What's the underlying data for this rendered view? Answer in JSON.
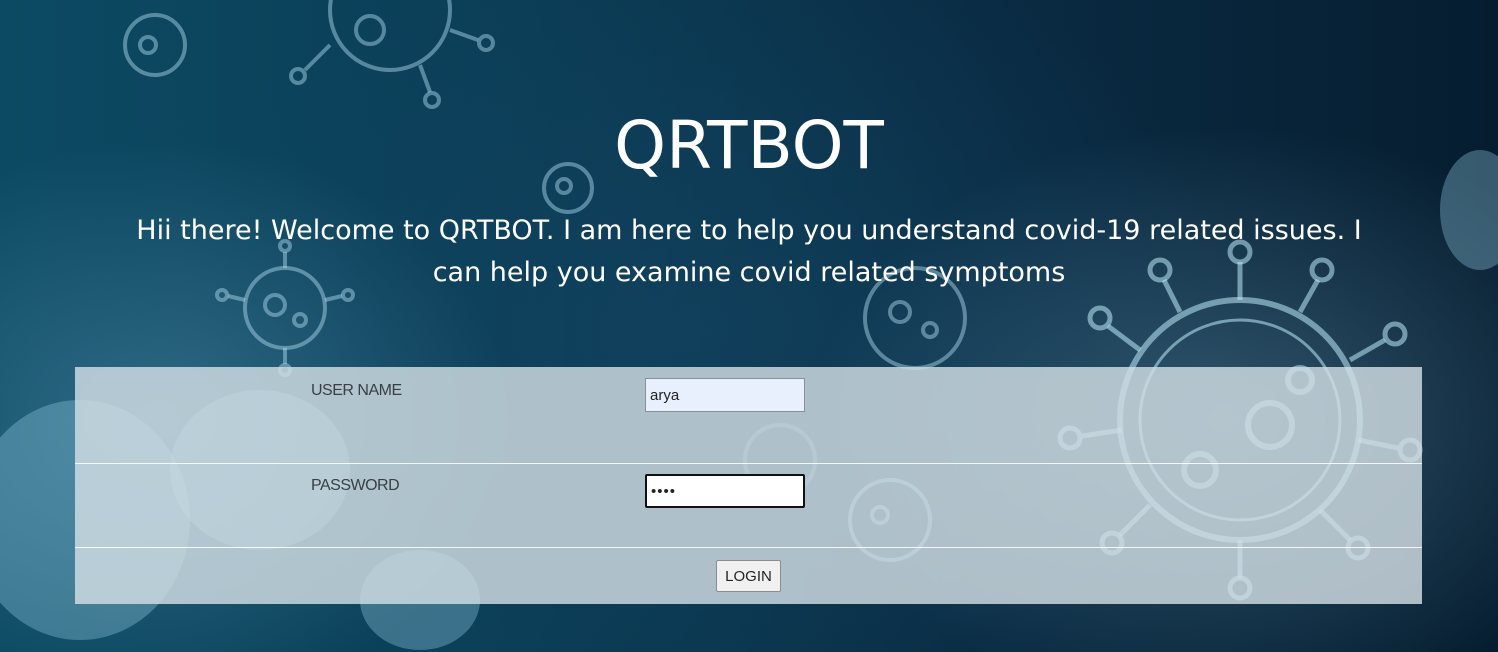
{
  "header": {
    "title": "QRTBOT",
    "welcome_text": "Hii there! Welcome to QRTBOT. I am here to help you understand covid-19 related issues. I can help you examine covid related symptoms"
  },
  "form": {
    "username_label": "USER NAME",
    "username_value": "arya",
    "password_label": "PASSWORD",
    "password_value": "arya",
    "login_label": "LOGIN"
  },
  "colors": {
    "background": "#0b3d56",
    "title_text": "#ffffff",
    "form_panel": "#d2dee4",
    "label_text": "#3a3f44",
    "autofill_field": "#e8f0fe"
  }
}
